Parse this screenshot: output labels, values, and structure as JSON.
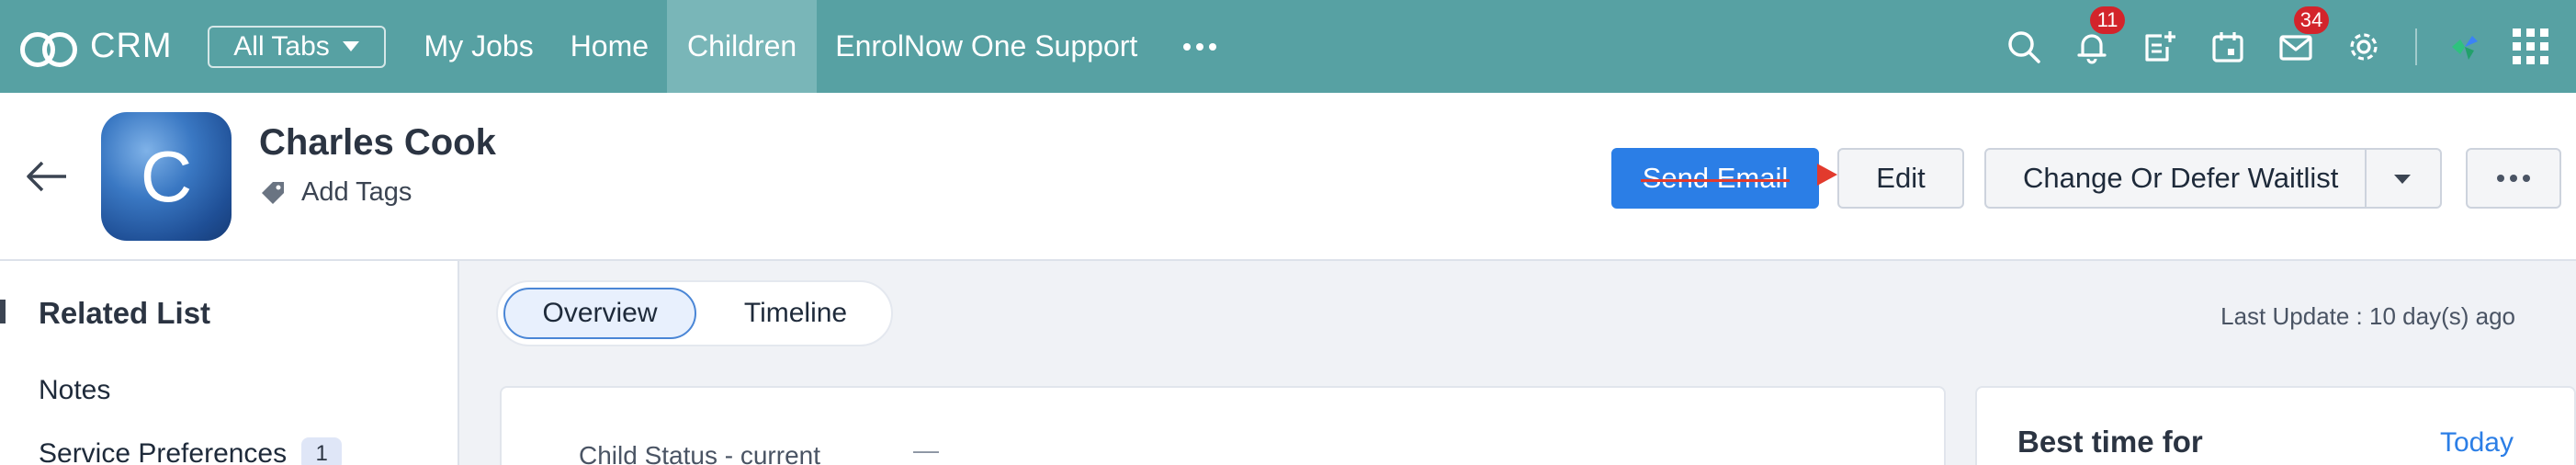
{
  "topbar": {
    "app_name": "CRM",
    "all_tabs_label": "All Tabs",
    "nav_items": [
      "My Jobs",
      "Home",
      "Children",
      "EnrolNow One Support"
    ],
    "active_nav": "Children",
    "notifications_count": "11",
    "mail_count": "34",
    "colors": {
      "bar": "#57a1a3",
      "active_tab": "#79b6b8",
      "badge": "#d3242b"
    }
  },
  "record": {
    "avatar_letter": "C",
    "name": "Charles Cook",
    "add_tags_label": "Add Tags",
    "send_email_label": "Send Email",
    "edit_label": "Edit",
    "change_waitlist_label": "Change Or Defer Waitlist"
  },
  "sidebar": {
    "title": "Related List",
    "items": [
      {
        "label": "Notes",
        "count": ""
      },
      {
        "label": "Service Preferences",
        "count": "1"
      }
    ]
  },
  "main": {
    "tabs": [
      "Overview",
      "Timeline"
    ],
    "active_tab": "Overview",
    "last_update": "Last Update : 10 day(s) ago",
    "fields": [
      {
        "label": "Child Status - current",
        "value": "—"
      }
    ],
    "best_time_title": "Best time for",
    "best_time_link": "Today"
  }
}
